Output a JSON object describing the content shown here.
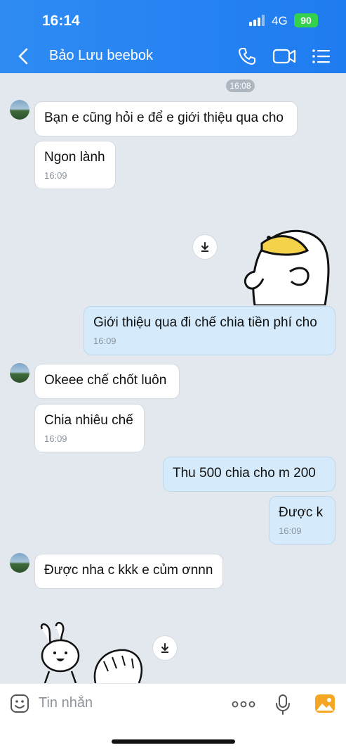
{
  "status_bar": {
    "time": "16:14",
    "network": "4G",
    "battery": "90"
  },
  "header": {
    "contact_name": "Bảo Lưu beebok",
    "icons": [
      "back-icon",
      "phone-icon",
      "video-call-icon",
      "menu-icon"
    ]
  },
  "chat": {
    "time_chip": "16:08",
    "messages": [
      {
        "from": "them",
        "text": "Bạn e cũng hỏi e để e giới thiệu qua cho",
        "time": ""
      },
      {
        "from": "them",
        "text": "Ngon lành",
        "time": "16:09"
      },
      {
        "from": "me",
        "type": "sticker",
        "name": "duck-sticker"
      },
      {
        "from": "me",
        "text": "Giới thiệu qua đi chế chia tiền phí cho",
        "time": "16:09"
      },
      {
        "from": "them",
        "text": "Okeee chế chốt luôn",
        "time": ""
      },
      {
        "from": "them",
        "text": "Chia nhiêu chế",
        "time": "16:09"
      },
      {
        "from": "me",
        "text": "Thu 500 chia cho m 200",
        "time": ""
      },
      {
        "from": "me",
        "text": "Được k",
        "time": "16:09"
      },
      {
        "from": "them",
        "text": "Được nha c kkk e củm ơnnn",
        "time": ""
      },
      {
        "from": "them",
        "type": "sticker",
        "name": "bunny-sticker"
      }
    ]
  },
  "composer": {
    "placeholder": "Tin nhắn",
    "icons": [
      "emoji-icon",
      "more-icon",
      "mic-icon",
      "image-icon"
    ]
  },
  "colors": {
    "header_blue": "#2f8bf3",
    "my_bubble": "#d5ebfb",
    "their_bubble": "#ffffff",
    "chat_bg": "#e3e8ee"
  }
}
